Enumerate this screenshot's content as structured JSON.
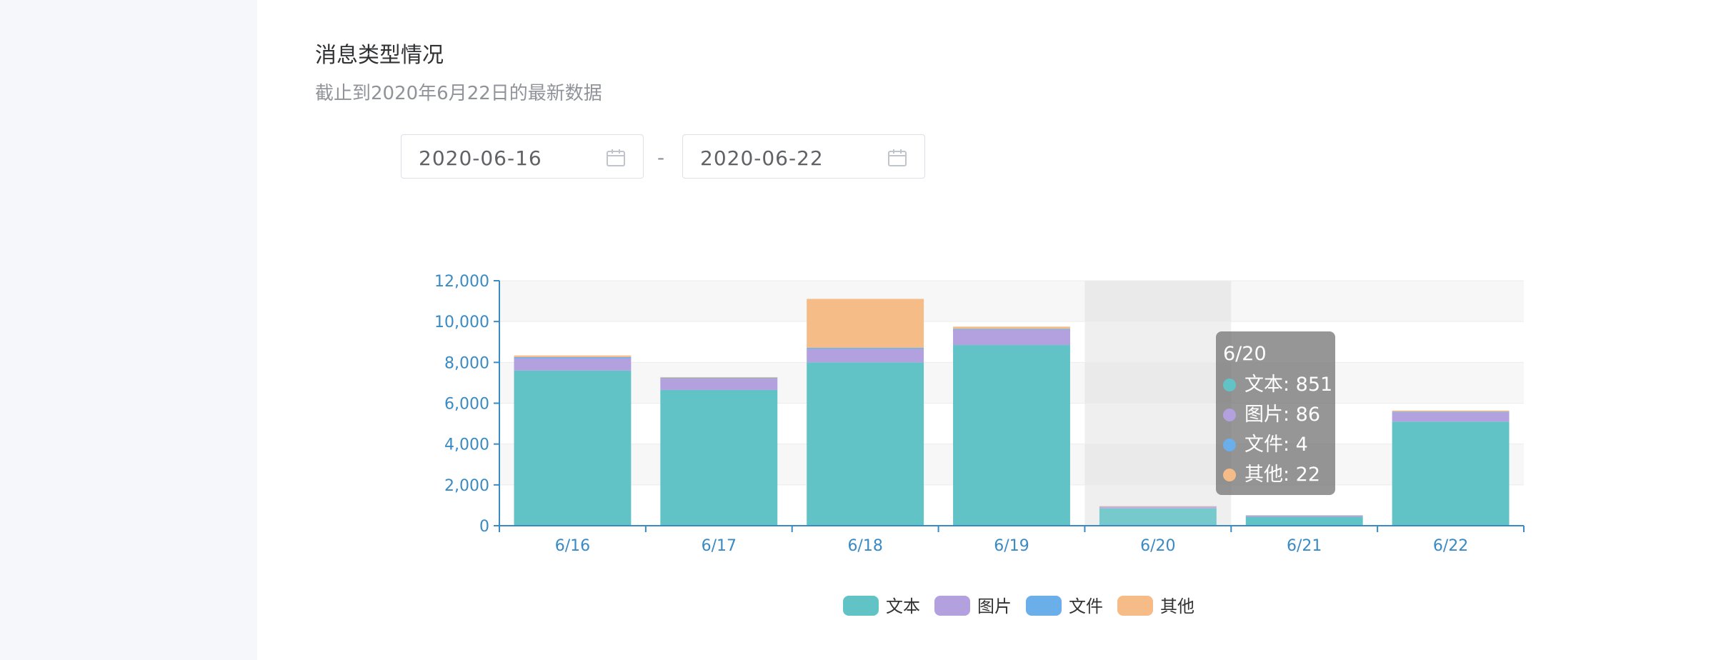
{
  "header": {
    "title": "消息类型情况",
    "subtitle": "截止到2020年6月22日的最新数据"
  },
  "date_range": {
    "start": "2020-06-16",
    "separator": "-",
    "end": "2020-06-22"
  },
  "colors": {
    "text": "#62c3c6",
    "image": "#b3a0de",
    "file": "#6aaeea",
    "other": "#f6bc88",
    "axis": "#3a8ac4"
  },
  "chart_data": {
    "type": "bar",
    "stacked": true,
    "categories": [
      "6/16",
      "6/17",
      "6/18",
      "6/19",
      "6/20",
      "6/21",
      "6/22"
    ],
    "series": [
      {
        "name": "文本",
        "values": [
          7600,
          6650,
          8000,
          8850,
          851,
          440,
          5100
        ]
      },
      {
        "name": "图片",
        "values": [
          600,
          550,
          650,
          750,
          86,
          60,
          450
        ]
      },
      {
        "name": "文件",
        "values": [
          60,
          40,
          60,
          40,
          4,
          5,
          30
        ]
      },
      {
        "name": "其他",
        "values": [
          80,
          40,
          2400,
          110,
          22,
          10,
          60
        ]
      }
    ],
    "ylim": [
      0,
      12000
    ],
    "yticks": [
      0,
      2000,
      4000,
      6000,
      8000,
      10000,
      12000
    ],
    "ytick_labels": [
      "0",
      "2,000",
      "4,000",
      "6,000",
      "8,000",
      "10,000",
      "12,000"
    ],
    "legend_position": "bottom-center",
    "grid": true,
    "highlight_category": "6/20",
    "tooltip": {
      "title": "6/20",
      "rows": [
        {
          "label": "文本: 851"
        },
        {
          "label": "图片: 86"
        },
        {
          "label": "文件: 4"
        },
        {
          "label": "其他: 22"
        }
      ]
    }
  }
}
